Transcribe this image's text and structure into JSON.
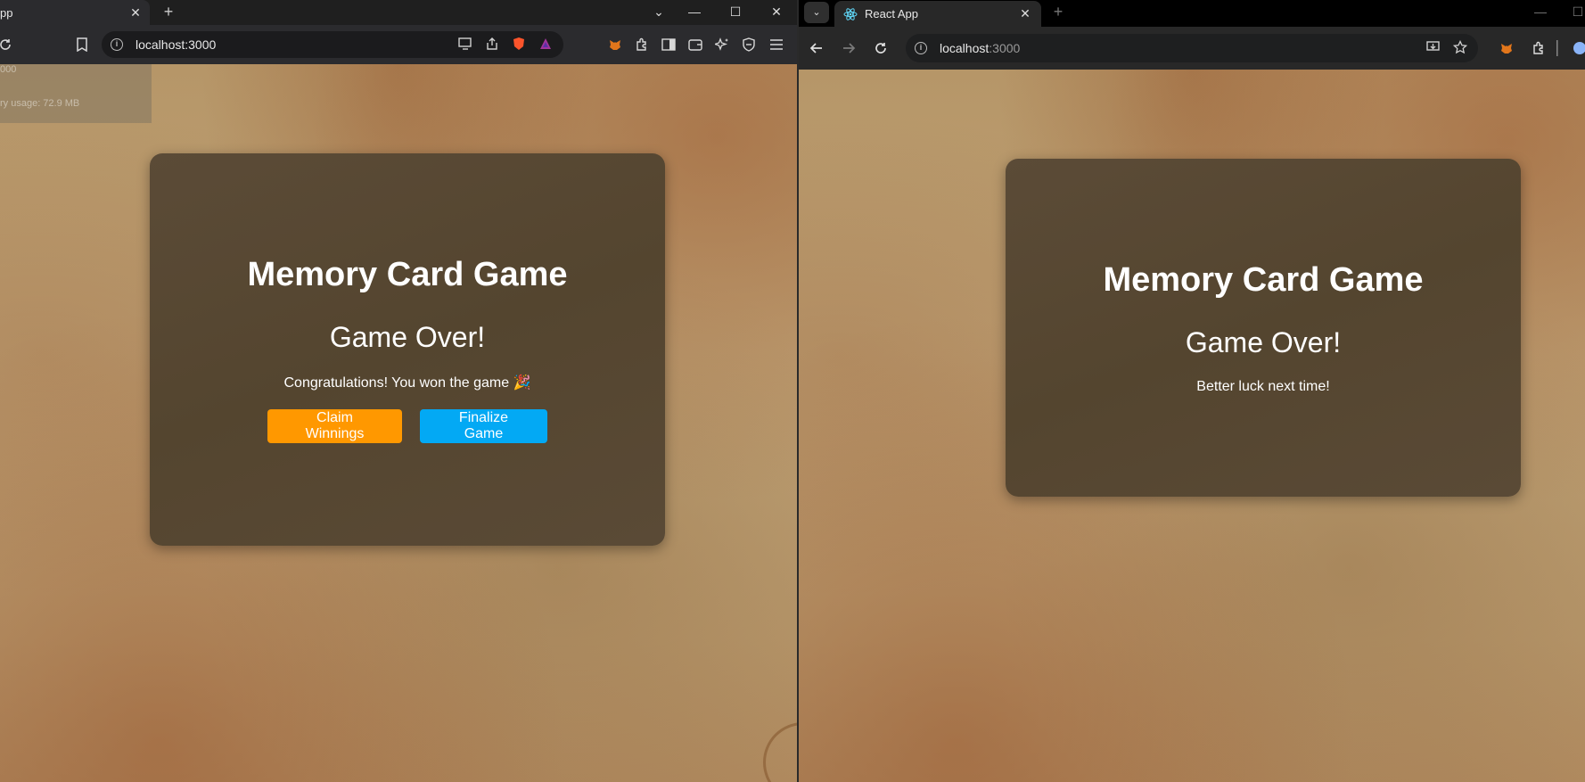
{
  "left": {
    "tab": {
      "title": "pp",
      "close": "✕"
    },
    "new_tab": "+",
    "window_controls": {
      "dropdown": "⌄",
      "minimize": "—",
      "maximize": "☐",
      "close": "✕"
    },
    "url": "localhost:3000",
    "dev_overlay": {
      "line1": "000",
      "line2": "ry usage: 72.9 MB"
    },
    "game": {
      "title": "Memory Card Game",
      "status": "Game Over!",
      "message": "Congratulations! You won the game 🎉",
      "claim_label": "Claim Winnings",
      "finalize_label": "Finalize Game"
    },
    "colors": {
      "claim_button": "#ff9800",
      "finalize_button": "#03a9f4"
    }
  },
  "right": {
    "tab": {
      "title": "React App",
      "close": "✕"
    },
    "new_tab": "+",
    "window_controls": {
      "minimize": "—",
      "maximize": "☐"
    },
    "url_host": "localhost",
    "url_port": ":3000",
    "game": {
      "title": "Memory Card Game",
      "status": "Game Over!",
      "message": "Better luck next time!"
    }
  }
}
